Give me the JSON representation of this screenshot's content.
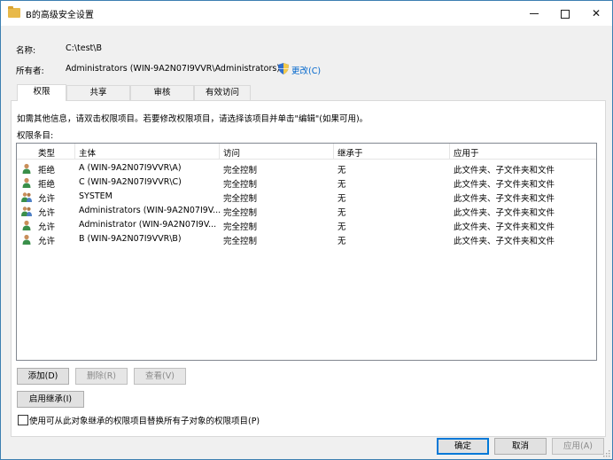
{
  "window": {
    "title": "B的高级安全设置"
  },
  "info": {
    "name_label": "名称:",
    "name_value": "C:\\test\\B",
    "owner_label": "所有者:",
    "owner_value": "Administrators (WIN-9A2N07I9VVR\\Administrators)",
    "change_link": "更改(C)"
  },
  "tabs": [
    {
      "label": "权限",
      "active": true
    },
    {
      "label": "共享",
      "active": false
    },
    {
      "label": "审核",
      "active": false
    },
    {
      "label": "有效访问",
      "active": false
    }
  ],
  "hint": "如需其他信息，请双击权限项目。若要修改权限项目，请选择该项目并单击\"编辑\"(如果可用)。",
  "entries_label": "权限条目:",
  "columns": [
    "类型",
    "主体",
    "访问",
    "继承于",
    "应用于"
  ],
  "rows": [
    {
      "type": "拒绝",
      "principal": "A (WIN-9A2N07I9VVR\\A)",
      "access": "完全控制",
      "inherited": "无",
      "applies": "此文件夹、子文件夹和文件",
      "icon": "user-icon"
    },
    {
      "type": "拒绝",
      "principal": "C (WIN-9A2N07I9VVR\\C)",
      "access": "完全控制",
      "inherited": "无",
      "applies": "此文件夹、子文件夹和文件",
      "icon": "user-icon"
    },
    {
      "type": "允许",
      "principal": "SYSTEM",
      "access": "完全控制",
      "inherited": "无",
      "applies": "此文件夹、子文件夹和文件",
      "icon": "group-icon"
    },
    {
      "type": "允许",
      "principal": "Administrators (WIN-9A2N07I9V...",
      "access": "完全控制",
      "inherited": "无",
      "applies": "此文件夹、子文件夹和文件",
      "icon": "group-icon"
    },
    {
      "type": "允许",
      "principal": "Administrator (WIN-9A2N07I9V...",
      "access": "完全控制",
      "inherited": "无",
      "applies": "此文件夹、子文件夹和文件",
      "icon": "user-icon"
    },
    {
      "type": "允许",
      "principal": "B (WIN-9A2N07I9VVR\\B)",
      "access": "完全控制",
      "inherited": "无",
      "applies": "此文件夹、子文件夹和文件",
      "icon": "user-icon"
    }
  ],
  "buttons": {
    "add": "添加(D)",
    "remove": "删除(R)",
    "view": "查看(V)",
    "enable_inheritance": "启用继承(I)"
  },
  "replace_checkbox": {
    "label": "使用可从此对象继承的权限项目替换所有子对象的权限项目(P)",
    "checked": false
  },
  "footer": {
    "ok": "确定",
    "cancel": "取消",
    "apply": "应用(A)"
  },
  "colors": {
    "accent": "#0078d7",
    "link": "#0066cc",
    "border": "#3c7fb1"
  }
}
